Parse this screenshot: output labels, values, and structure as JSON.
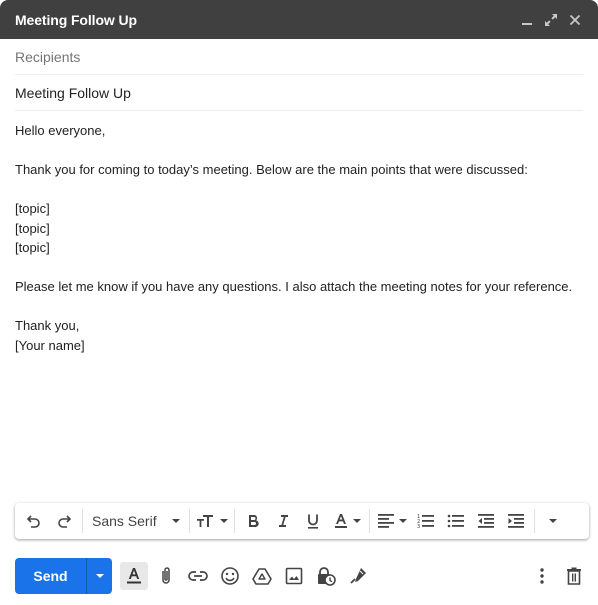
{
  "window": {
    "title": "Meeting Follow Up",
    "icons": [
      "minimize-icon",
      "expand-icon",
      "close-icon"
    ]
  },
  "fields": {
    "recipients_placeholder": "Recipients",
    "subject_value": "Meeting Follow Up"
  },
  "body": {
    "lines": [
      "Hello everyone,",
      "",
      "Thank you for coming to today’s meeting. Below are the main points that were discussed:",
      "",
      "[topic]",
      "[topic]",
      "[topic]",
      "",
      "Please let me know if you have any questions. I also attach the meeting notes for your reference.",
      "",
      "Thank you,",
      "[Your name]"
    ]
  },
  "format_toolbar": {
    "font": "Sans Serif",
    "buttons": [
      "undo",
      "redo",
      "font",
      "text-size",
      "bold",
      "italic",
      "underline",
      "text-color",
      "align",
      "numbered-list",
      "bulleted-list",
      "indent-less",
      "indent-more",
      "more-formatting"
    ]
  },
  "bottom_bar": {
    "send_label": "Send",
    "tools": [
      "formatting-options",
      "attach-files",
      "insert-link",
      "insert-emoji",
      "insert-drive",
      "insert-photo",
      "confidential-mode",
      "insert-signature"
    ],
    "right": [
      "more-options",
      "discard-draft"
    ]
  },
  "colors": {
    "titlebar": "#404040",
    "send_button": "#1a73e8",
    "icon": "#444444"
  }
}
